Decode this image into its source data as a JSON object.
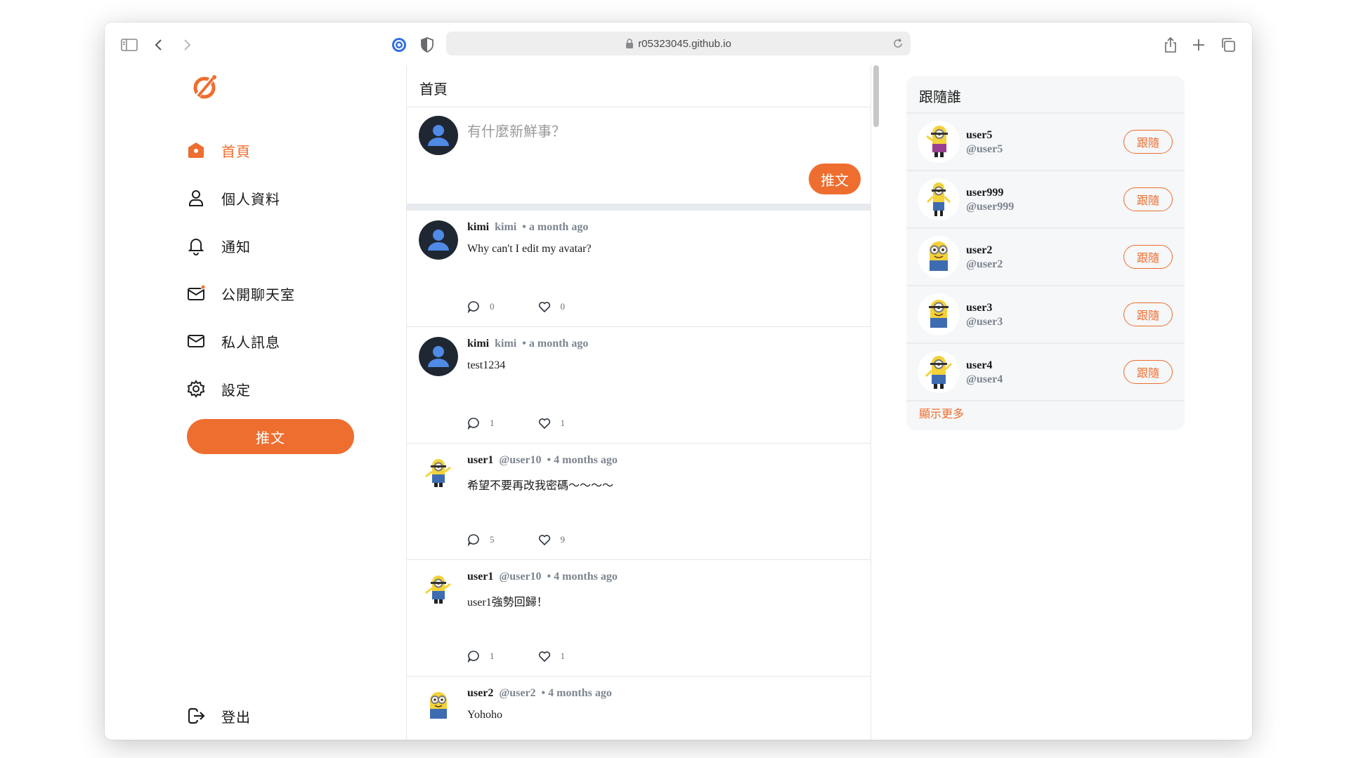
{
  "browser": {
    "url": "r05323045.github.io"
  },
  "colors": {
    "brand": "#ee6e2f",
    "muted": "#7d8590"
  },
  "sidebar": {
    "items": [
      {
        "label": "首頁",
        "icon": "home-icon",
        "active": true
      },
      {
        "label": "個人資料",
        "icon": "user-icon"
      },
      {
        "label": "通知",
        "icon": "bell-icon"
      },
      {
        "label": "公開聊天室",
        "icon": "mail-dot-icon"
      },
      {
        "label": "私人訊息",
        "icon": "mail-icon"
      },
      {
        "label": "設定",
        "icon": "gear-icon"
      }
    ],
    "tweet_button": "推文",
    "logout": "登出"
  },
  "main": {
    "title": "首頁",
    "compose": {
      "placeholder": "有什麼新鮮事？",
      "button": "推文"
    },
    "posts": [
      {
        "name": "kimi",
        "account": "kimi",
        "time": "a month ago",
        "text": "Why can't I edit my avatar?",
        "replies": "0",
        "likes": "0",
        "avatar": "default"
      },
      {
        "name": "kimi",
        "account": "kimi",
        "time": "a month ago",
        "text": "test1234",
        "replies": "1",
        "likes": "1",
        "avatar": "default"
      },
      {
        "name": "user1",
        "account": "@user10",
        "time": "4 months ago",
        "text": "希望不要再改我密碼～～～～",
        "replies": "5",
        "likes": "9",
        "avatar": "minion"
      },
      {
        "name": "user1",
        "account": "@user10",
        "time": "4 months ago",
        "text": "user1強勢回歸！",
        "replies": "1",
        "likes": "1",
        "avatar": "minion"
      },
      {
        "name": "user2",
        "account": "@user2",
        "time": "4 months ago",
        "text": "Yohoho",
        "replies": "",
        "likes": "",
        "avatar": "minion"
      }
    ]
  },
  "follow": {
    "title": "跟隨誰",
    "users": [
      {
        "name": "user5",
        "account": "@user5",
        "button": "跟隨"
      },
      {
        "name": "user999",
        "account": "@user999",
        "button": "跟隨"
      },
      {
        "name": "user2",
        "account": "@user2",
        "button": "跟隨"
      },
      {
        "name": "user3",
        "account": "@user3",
        "button": "跟隨"
      },
      {
        "name": "user4",
        "account": "@user4",
        "button": "跟隨"
      }
    ],
    "show_more": "顯示更多"
  }
}
